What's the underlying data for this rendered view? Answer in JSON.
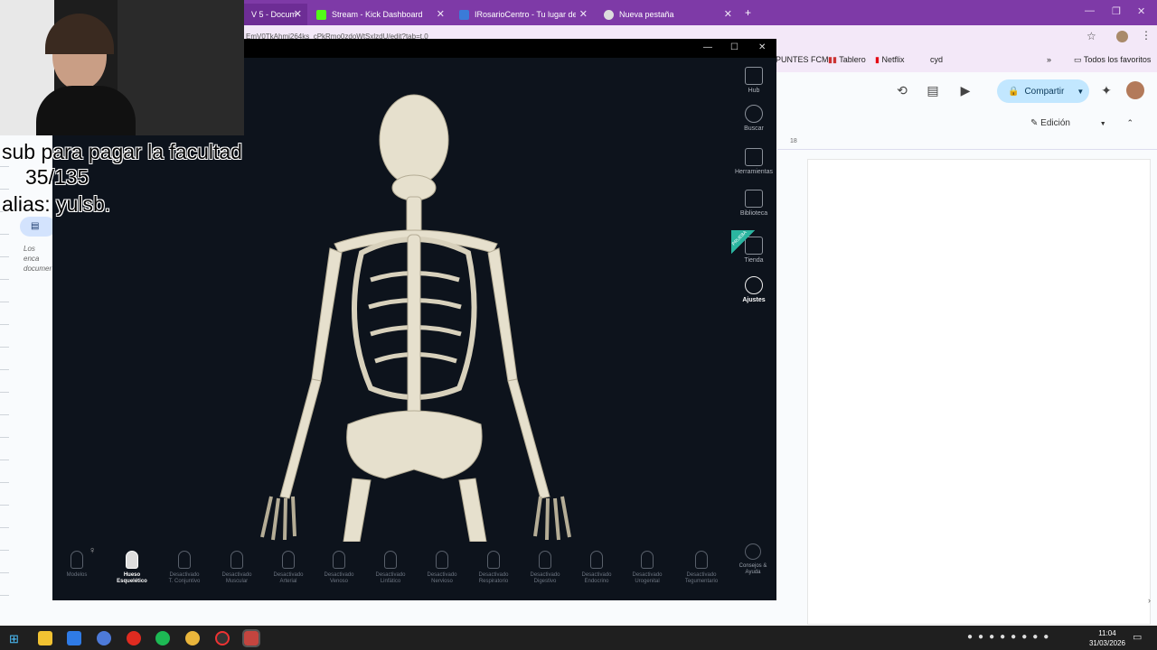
{
  "browser": {
    "tabs": [
      {
        "label": "V 5 - Docum",
        "active": true
      },
      {
        "label": "Stream - Kick Dashboard",
        "active": false
      },
      {
        "label": "IRosarioCentro - Tu lugar de te",
        "active": false
      },
      {
        "label": "Nueva pestaña",
        "active": false
      }
    ],
    "new_tab": "+",
    "url": "EmV0TkAhmi264ks_cPkRmo0zdoWtSxlzdU/edit?tab=t.0",
    "bookmarks": [
      "PUNTES FCM",
      "Tablero",
      "Netflix",
      "cyd"
    ],
    "all_favorites": "Todos los favoritos"
  },
  "docs": {
    "share_label": "Compartir",
    "mode_label": "Edición",
    "ruler_mark": "18",
    "side_text": "Los enca documer"
  },
  "overlay": {
    "line1": "sub para pagar la facultad",
    "line2": "35/135",
    "line3": "alias: yulsb."
  },
  "anatomy_app": {
    "right_panel": [
      {
        "label": "Hub",
        "icon": "hub-icon"
      },
      {
        "label": "Buscar",
        "icon": "search-icon"
      },
      {
        "label": "Herramientas",
        "icon": "tools-icon"
      },
      {
        "label": "Biblioteca",
        "icon": "library-icon"
      },
      {
        "label": "Tienda",
        "icon": "store-icon"
      },
      {
        "label": "Ajustes",
        "icon": "gear-icon"
      }
    ],
    "store_badge": "PRUEBA",
    "bottom": {
      "modelos": "Modelos",
      "systems": [
        {
          "l1": "Hueso",
          "l2": "Esquelético",
          "on": true
        },
        {
          "l1": "Desactivado",
          "l2": "T. Conjuntivo",
          "on": false
        },
        {
          "l1": "Desactivado",
          "l2": "Muscular",
          "on": false
        },
        {
          "l1": "Desactivado",
          "l2": "Arterial",
          "on": false
        },
        {
          "l1": "Desactivado",
          "l2": "Venoso",
          "on": false
        },
        {
          "l1": "Desactivado",
          "l2": "Linfático",
          "on": false
        },
        {
          "l1": "Desactivado",
          "l2": "Nervioso",
          "on": false
        },
        {
          "l1": "Desactivado",
          "l2": "Respiratorio",
          "on": false
        },
        {
          "l1": "Desactivado",
          "l2": "Digestivo",
          "on": false
        },
        {
          "l1": "Desactivado",
          "l2": "Endocrino",
          "on": false
        },
        {
          "l1": "Desactivado",
          "l2": "Urogenital",
          "on": false
        },
        {
          "l1": "Desactivado",
          "l2": "Tegumentario",
          "on": false
        }
      ],
      "help_l1": "Consejos &",
      "help_l2": "Ayuda"
    }
  },
  "taskbar": {
    "time": "11:04",
    "date": "31/03/2026"
  }
}
